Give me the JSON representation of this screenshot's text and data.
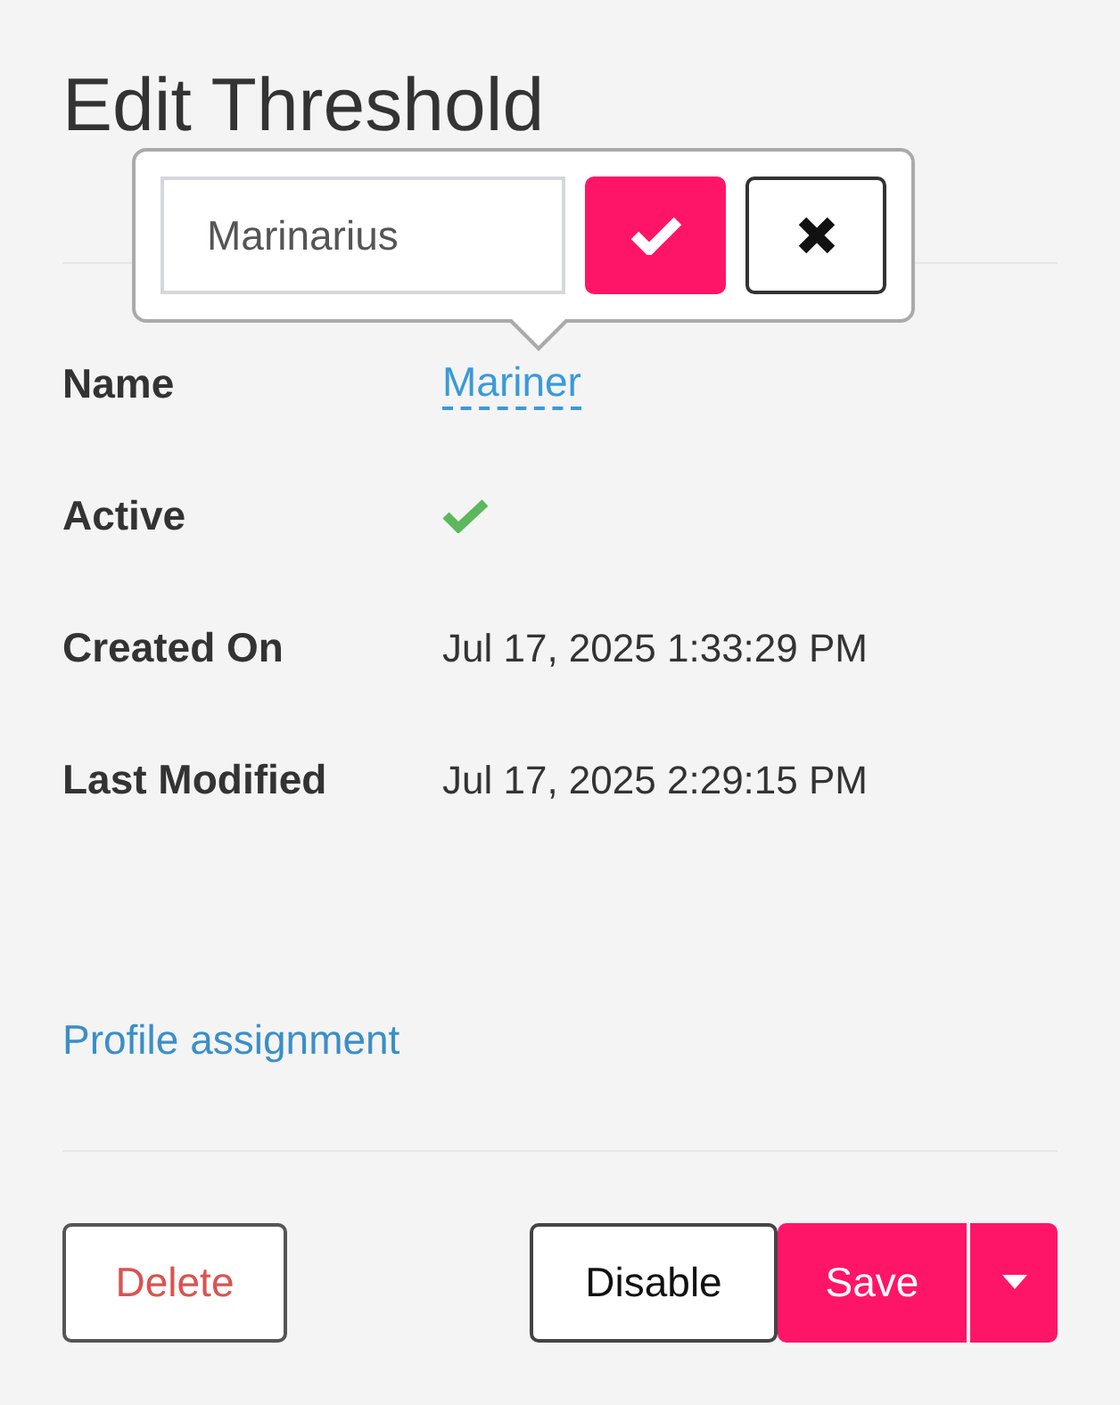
{
  "title": "Edit Threshold",
  "popover": {
    "value": "Marinarius"
  },
  "fields": [
    {
      "label": "Name",
      "kind": "editable",
      "value": "Mariner"
    },
    {
      "label": "Active",
      "kind": "boolean",
      "active": true
    },
    {
      "label": "Created On",
      "kind": "text",
      "value": "Jul 17, 2025 1:33:29 PM"
    },
    {
      "label": "Last Modified",
      "kind": "text",
      "value": "Jul 17, 2025 2:29:15 PM"
    }
  ],
  "link": "Profile assignment",
  "buttons": {
    "delete": "Delete",
    "disable": "Disable",
    "save": "Save"
  }
}
